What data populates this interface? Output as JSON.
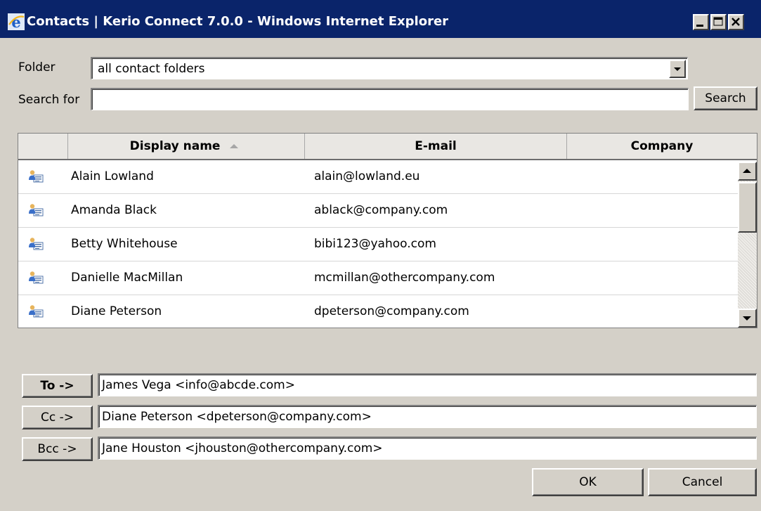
{
  "window": {
    "title": "Contacts | Kerio Connect 7.0.0 - Windows Internet Explorer"
  },
  "folder": {
    "label": "Folder",
    "value": "all contact folders"
  },
  "search": {
    "label": "Search for",
    "value": "",
    "button_label": "Search"
  },
  "contacts_table": {
    "columns": [
      "Display name",
      "E-mail",
      "Company"
    ],
    "sort_column": "Display name",
    "sort_direction": "ascending",
    "rows": [
      {
        "icon": "contact-card-icon",
        "name": "Alain Lowland",
        "email": "alain@lowland.eu",
        "company": ""
      },
      {
        "icon": "contact-card-icon",
        "name": "Amanda Black",
        "email": "ablack@company.com",
        "company": ""
      },
      {
        "icon": "contact-card-icon",
        "name": "Betty Whitehouse",
        "email": "bibi123@yahoo.com",
        "company": ""
      },
      {
        "icon": "contact-card-icon",
        "name": "Danielle MacMillan",
        "email": "mcmillan@othercompany.com",
        "company": ""
      },
      {
        "icon": "contact-card-icon",
        "name": "Diane Peterson",
        "email": "dpeterson@company.com",
        "company": ""
      }
    ]
  },
  "recipients": {
    "to": {
      "label": "To ->",
      "value": "James Vega <info@abcde.com>"
    },
    "cc": {
      "label": "Cc ->",
      "value": "Diane Peterson <dpeterson@company.com>"
    },
    "bcc": {
      "label": "Bcc ->",
      "value": "Jane Houston <jhouston@othercompany.com>"
    }
  },
  "actions": {
    "ok_label": "OK",
    "cancel_label": "Cancel"
  },
  "colors": {
    "titlebar": "#0a246a",
    "dialog_background": "#d4d0c8"
  }
}
